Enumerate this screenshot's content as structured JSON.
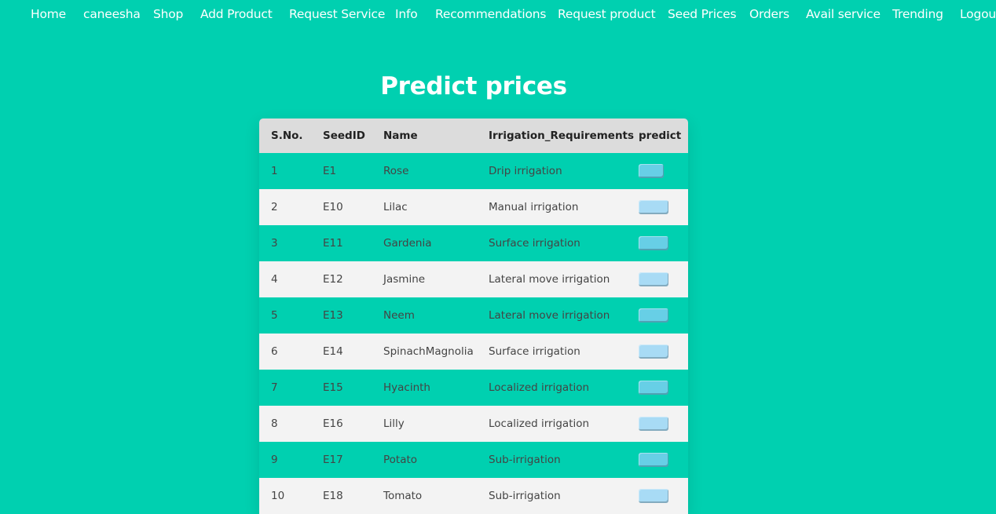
{
  "nav": {
    "items": [
      "Home",
      "caneesha",
      "Shop",
      "Add Product",
      "Request Service",
      "Info",
      "Recommendations",
      "Request product",
      "Seed Prices",
      "Orders",
      "Avail service",
      "Trending",
      "Logout"
    ]
  },
  "page": {
    "title": "Predict prices"
  },
  "table": {
    "headers": [
      "S.No.",
      "SeedID",
      "Name",
      "Irrigation_Requirements",
      "predict"
    ],
    "rows": [
      {
        "sno": "1",
        "seed_id": "E1",
        "name": "Rose",
        "irrigation": "Drip irrigation"
      },
      {
        "sno": "2",
        "seed_id": "E10",
        "name": "Lilac",
        "irrigation": "Manual irrigation"
      },
      {
        "sno": "3",
        "seed_id": "E11",
        "name": "Gardenia",
        "irrigation": "Surface irrigation"
      },
      {
        "sno": "4",
        "seed_id": "E12",
        "name": "Jasmine",
        "irrigation": "Lateral move irrigation"
      },
      {
        "sno": "5",
        "seed_id": "E13",
        "name": "Neem",
        "irrigation": "Lateral move irrigation"
      },
      {
        "sno": "6",
        "seed_id": "E14",
        "name": "SpinachMagnolia",
        "irrigation": "Surface irrigation"
      },
      {
        "sno": "7",
        "seed_id": "E15",
        "name": "Hyacinth",
        "irrigation": "Localized irrigation"
      },
      {
        "sno": "8",
        "seed_id": "E16",
        "name": "Lilly",
        "irrigation": "Localized irrigation"
      },
      {
        "sno": "9",
        "seed_id": "E17",
        "name": "Potato",
        "irrigation": "Sub-irrigation"
      },
      {
        "sno": "10",
        "seed_id": "E18",
        "name": "Tomato",
        "irrigation": "Sub-irrigation"
      }
    ]
  },
  "colors": {
    "background": "#00d0b0",
    "header_bg": "#dcdcdc",
    "even_row_bg": "#f3f3f3",
    "button_odd": "#67cfe6",
    "button_even": "#a8dbf5"
  }
}
